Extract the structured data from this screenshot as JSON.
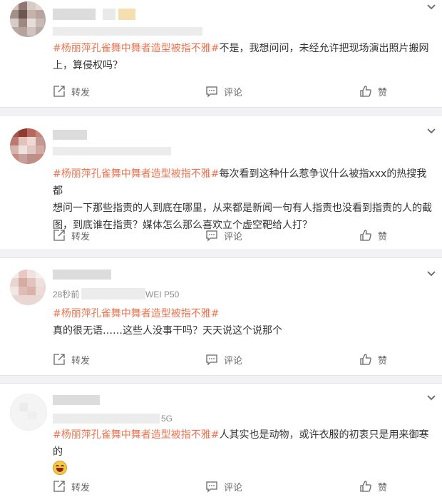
{
  "colors": {
    "tag": "#eb7350",
    "text": "#333333",
    "muted": "#8c8c8c",
    "separator": "#f2f2f5"
  },
  "icons": {
    "repost": "repost-icon",
    "comment": "comment-icon",
    "like": "thumbs-up-icon",
    "menu": "chevron-down-icon"
  },
  "actions": {
    "repost": "转发",
    "comment": "评论",
    "like": "赞"
  },
  "posts": [
    {
      "tag": "#杨丽萍孔雀舞中舞者造型被指不雅#",
      "line1": "不是，我想问问，未经允许把现场演出照片搬网",
      "line2": "上，算侵权吗？",
      "meta": ""
    },
    {
      "tag": "#杨丽萍孔雀舞中舞者造型被指不雅#",
      "line1": "每次看到这种什么惹争议什么被指xxx的热搜我都",
      "line2": "想问一下那些指责的人到底在哪里，从来都是新闻一句有人指责也没看到指责的人的截",
      "line3": "图，到底谁在指责？媒体怎么那么喜欢立个虚空靶给人打？",
      "meta": ""
    },
    {
      "tag": "#杨丽萍孔雀舞中舞者造型被指不雅#",
      "line1": "真的很无语……这些人没事干吗？天天说这个说那个",
      "meta_left": "28秒前",
      "meta_right": "WEI P50"
    },
    {
      "tag": "#杨丽萍孔雀舞中舞者造型被指不雅#",
      "line1": "人其实也是动物，或许衣服的初衷只是用来御寒的",
      "meta": "5G"
    }
  ]
}
